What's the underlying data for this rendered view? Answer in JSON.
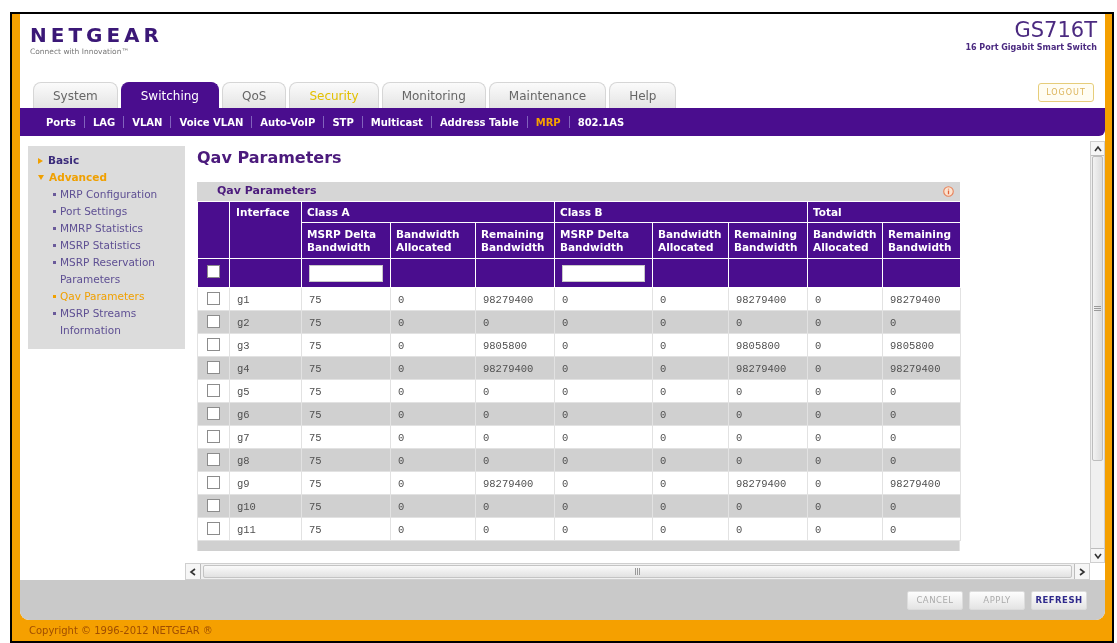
{
  "header": {
    "logo": "NETGEAR",
    "tagline": "Connect with Innovation™",
    "model": "GS716T",
    "model_description": "16 Port Gigabit Smart Switch"
  },
  "tabs": [
    {
      "label": "System",
      "selected": false,
      "highlighted": false
    },
    {
      "label": "Switching",
      "selected": true,
      "highlighted": false
    },
    {
      "label": "QoS",
      "selected": false,
      "highlighted": false
    },
    {
      "label": "Security",
      "selected": false,
      "highlighted": true
    },
    {
      "label": "Monitoring",
      "selected": false,
      "highlighted": false
    },
    {
      "label": "Maintenance",
      "selected": false,
      "highlighted": false
    },
    {
      "label": "Help",
      "selected": false,
      "highlighted": false
    }
  ],
  "logout_button": {
    "label": "LOGOUT"
  },
  "subnav": [
    {
      "label": "Ports",
      "selected": false
    },
    {
      "label": "LAG",
      "selected": false
    },
    {
      "label": "VLAN",
      "selected": false
    },
    {
      "label": "Voice VLAN",
      "selected": false
    },
    {
      "label": "Auto-VoIP",
      "selected": false
    },
    {
      "label": "STP",
      "selected": false
    },
    {
      "label": "Multicast",
      "selected": false
    },
    {
      "label": "Address Table",
      "selected": false
    },
    {
      "label": "MRP",
      "selected": true
    },
    {
      "label": "802.1AS",
      "selected": false
    }
  ],
  "sidebar": {
    "items": [
      {
        "label": "Basic",
        "expanded": false,
        "selected": false
      },
      {
        "label": "Advanced",
        "expanded": true,
        "selected": true,
        "children": [
          {
            "label": "MRP Configuration",
            "selected": false
          },
          {
            "label": "Port Settings",
            "selected": false
          },
          {
            "label": "MMRP Statistics",
            "selected": false
          },
          {
            "label": "MSRP Statistics",
            "selected": false
          },
          {
            "label": "MSRP Reservation Parameters",
            "selected": false
          },
          {
            "label": "Qav Parameters",
            "selected": true
          },
          {
            "label": "MSRP Streams Information",
            "selected": false
          }
        ]
      }
    ]
  },
  "page_title": "Qav Parameters",
  "panel": {
    "title": "Qav Parameters",
    "table": {
      "interface_header": "Interface",
      "groups": [
        {
          "label": "Class A",
          "columns": [
            {
              "label": "MSRP Delta Bandwidth",
              "editable": true
            },
            {
              "label": "Bandwidth Allocated",
              "editable": false
            },
            {
              "label": "Remaining Bandwidth",
              "editable": false
            }
          ]
        },
        {
          "label": "Class B",
          "columns": [
            {
              "label": "MSRP Delta Bandwidth",
              "editable": true
            },
            {
              "label": "Bandwidth Allocated",
              "editable": false
            },
            {
              "label": "Remaining Bandwidth",
              "editable": false
            }
          ]
        },
        {
          "label": "Total",
          "columns": [
            {
              "label": "Bandwidth Allocated",
              "editable": false
            },
            {
              "label": "Remaining Bandwidth",
              "editable": false
            }
          ]
        }
      ],
      "select_all": {
        "checked": false
      },
      "rows": [
        {
          "checked": false,
          "cells": [
            "g1",
            "75",
            "0",
            "98279400",
            "0",
            "0",
            "98279400",
            "0",
            "98279400"
          ]
        },
        {
          "checked": false,
          "cells": [
            "g2",
            "75",
            "0",
            "0",
            "0",
            "0",
            "0",
            "0",
            "0"
          ]
        },
        {
          "checked": false,
          "cells": [
            "g3",
            "75",
            "0",
            "9805800",
            "0",
            "0",
            "9805800",
            "0",
            "9805800"
          ]
        },
        {
          "checked": false,
          "cells": [
            "g4",
            "75",
            "0",
            "98279400",
            "0",
            "0",
            "98279400",
            "0",
            "98279400"
          ]
        },
        {
          "checked": false,
          "cells": [
            "g5",
            "75",
            "0",
            "0",
            "0",
            "0",
            "0",
            "0",
            "0"
          ]
        },
        {
          "checked": false,
          "cells": [
            "g6",
            "75",
            "0",
            "0",
            "0",
            "0",
            "0",
            "0",
            "0"
          ]
        },
        {
          "checked": false,
          "cells": [
            "g7",
            "75",
            "0",
            "0",
            "0",
            "0",
            "0",
            "0",
            "0"
          ]
        },
        {
          "checked": false,
          "cells": [
            "g8",
            "75",
            "0",
            "0",
            "0",
            "0",
            "0",
            "0",
            "0"
          ]
        },
        {
          "checked": false,
          "cells": [
            "g9",
            "75",
            "0",
            "98279400",
            "0",
            "0",
            "98279400",
            "0",
            "98279400"
          ]
        },
        {
          "checked": false,
          "cells": [
            "g10",
            "75",
            "0",
            "0",
            "0",
            "0",
            "0",
            "0",
            "0"
          ]
        },
        {
          "checked": false,
          "cells": [
            "g11",
            "75",
            "0",
            "0",
            "0",
            "0",
            "0",
            "0",
            "0"
          ]
        }
      ]
    }
  },
  "buttons": [
    {
      "label": "CANCEL",
      "disabled": true
    },
    {
      "label": "APPLY",
      "disabled": true
    },
    {
      "label": "REFRESH",
      "disabled": false
    }
  ],
  "footer": {
    "copyright": "Copyright © 1996-2012 NETGEAR ®"
  }
}
